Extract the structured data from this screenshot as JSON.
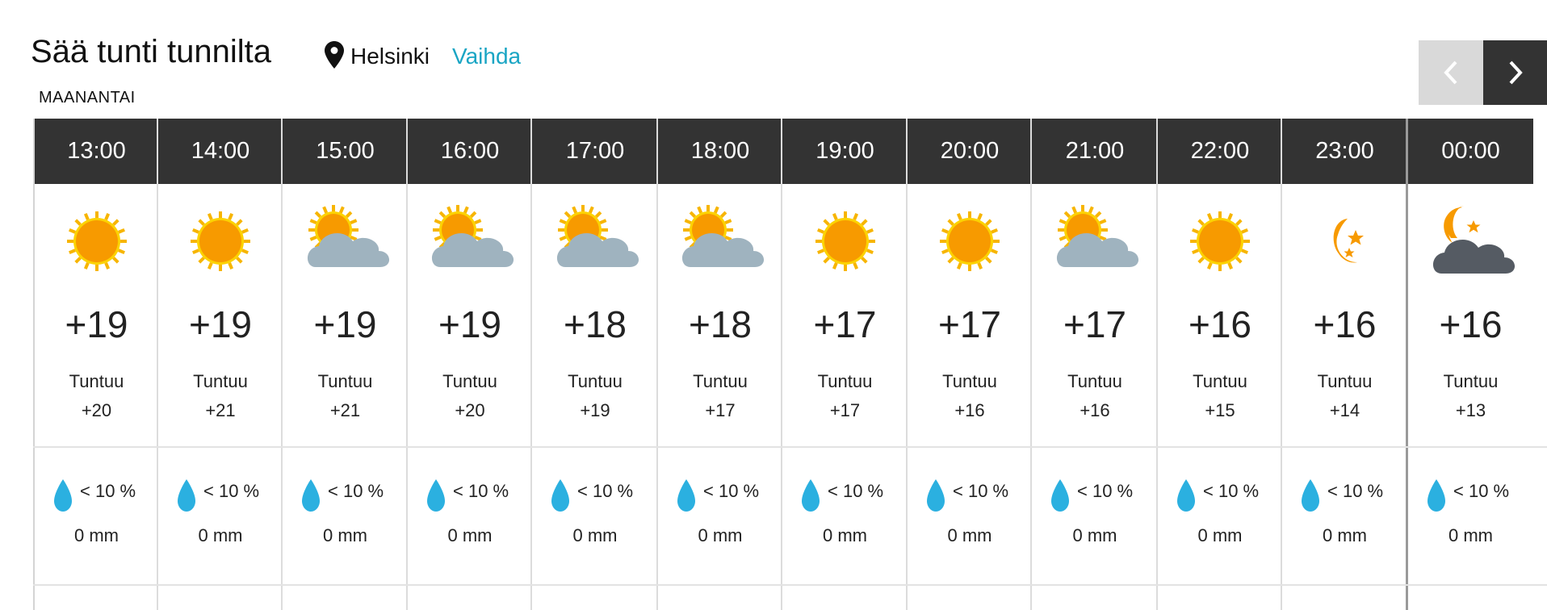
{
  "header": {
    "title": "Sää tunti tunnilta",
    "location": "Helsinki",
    "change_link": "Vaihda",
    "day_label": "MAANANTAI"
  },
  "colors": {
    "header_bg": "#333333",
    "accent_link": "#1aa5c4",
    "sun": "#f7a600",
    "rain_drop": "#2bb0e0",
    "cloud": "#9fb3bf",
    "night_cloud": "#555b63"
  },
  "labels": {
    "feels_like": "Tuntuu"
  },
  "forecast": [
    {
      "time": "13:00",
      "icon": "sun-icon",
      "temp": "+19",
      "feels": "+20",
      "precip_prob": "< 10 %",
      "precip_amount": "0 mm"
    },
    {
      "time": "14:00",
      "icon": "sun-icon",
      "temp": "+19",
      "feels": "+21",
      "precip_prob": "< 10 %",
      "precip_amount": "0 mm"
    },
    {
      "time": "15:00",
      "icon": "partly-cloudy-icon",
      "temp": "+19",
      "feels": "+21",
      "precip_prob": "< 10 %",
      "precip_amount": "0 mm"
    },
    {
      "time": "16:00",
      "icon": "partly-cloudy-icon",
      "temp": "+19",
      "feels": "+20",
      "precip_prob": "< 10 %",
      "precip_amount": "0 mm"
    },
    {
      "time": "17:00",
      "icon": "partly-cloudy-icon",
      "temp": "+18",
      "feels": "+19",
      "precip_prob": "< 10 %",
      "precip_amount": "0 mm"
    },
    {
      "time": "18:00",
      "icon": "partly-cloudy-icon",
      "temp": "+18",
      "feels": "+17",
      "precip_prob": "< 10 %",
      "precip_amount": "0 mm"
    },
    {
      "time": "19:00",
      "icon": "sun-icon",
      "temp": "+17",
      "feels": "+17",
      "precip_prob": "< 10 %",
      "precip_amount": "0 mm"
    },
    {
      "time": "20:00",
      "icon": "sun-icon",
      "temp": "+17",
      "feels": "+16",
      "precip_prob": "< 10 %",
      "precip_amount": "0 mm"
    },
    {
      "time": "21:00",
      "icon": "partly-cloudy-icon",
      "temp": "+17",
      "feels": "+16",
      "precip_prob": "< 10 %",
      "precip_amount": "0 mm"
    },
    {
      "time": "22:00",
      "icon": "sun-icon",
      "temp": "+16",
      "feels": "+15",
      "precip_prob": "< 10 %",
      "precip_amount": "0 mm"
    },
    {
      "time": "23:00",
      "icon": "moon-stars-icon",
      "temp": "+16",
      "feels": "+14",
      "precip_prob": "< 10 %",
      "precip_amount": "0 mm"
    },
    {
      "time": "00:00",
      "icon": "night-cloudy-icon",
      "temp": "+16",
      "feels": "+13",
      "precip_prob": "< 10 %",
      "precip_amount": "0 mm"
    }
  ]
}
